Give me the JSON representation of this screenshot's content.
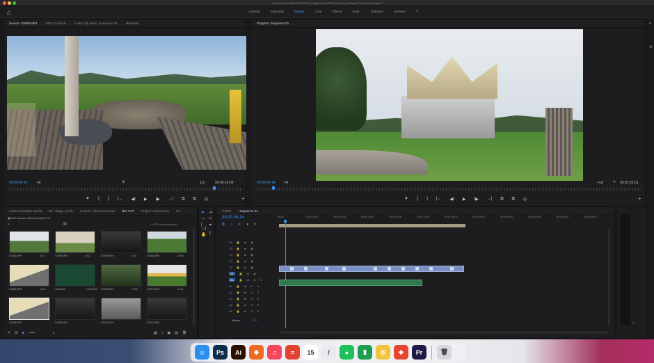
{
  "window": {
    "title": "/Volumes/Drive/Media/2023/Trip-village-resort/2023_start_to_Lifestyle/Tour/Sheet-project *"
  },
  "workspaces": {
    "items": [
      "Learning",
      "Assembly",
      "Editing",
      "Color",
      "Effects",
      "Audio",
      "Graphics",
      "Libraries"
    ],
    "active": "Editing",
    "more": "»"
  },
  "source_panel": {
    "tabs": [
      "Source: C0005.MP4",
      "Effect Controls",
      "Audio Clip Mixer: Sequence 01",
      "Metadata"
    ],
    "timecode": "00:00:04:14",
    "fit": "Fit",
    "duration": "00:00:14:00",
    "ratio": "1/2"
  },
  "program_panel": {
    "tabs": [
      "Program: Sequence 01"
    ],
    "timecode": "00:00:04:14",
    "fit": "Fit",
    "duration": "00:01:33:01",
    "ratio": "Full"
  },
  "transport": {
    "buttons": [
      "▼",
      "{",
      "}",
      "|←",
      "◀I",
      "▶",
      "I▶",
      "→|",
      "⧉",
      "⧉",
      "◎"
    ]
  },
  "project_panel": {
    "tabs": [
      "Lifeline Template Media",
      "Bin: Stage_music",
      "Project: Lofi lessons.mp4",
      "Bin: EAT",
      "Project: Lofi lessons",
      "Pic"
    ],
    "path": "Lofi: lessons Sheet-project-FLS",
    "count": "1 of 75 items selected",
    "items": [
      {
        "name": "C0001.MP4",
        "dur": "6:12",
        "style": "t-sky"
      },
      {
        "name": "C0002.MP4",
        "dur": "5:12",
        "style": "t-bldg"
      },
      {
        "name": "C0003.MP4",
        "dur": "4:10",
        "style": "t-dark"
      },
      {
        "name": "C0004.MP4",
        "dur": "15:00",
        "style": "t-green"
      },
      {
        "name": "C0005.MP4",
        "dur": "14:11",
        "style": "t-roof"
      },
      {
        "name": "Thethane",
        "dur": "1:31:19:00",
        "style": "t-audio"
      },
      {
        "name": "C0006.MP4",
        "dur": "10:00",
        "style": "t-forest"
      },
      {
        "name": "C0007.MP4",
        "dur": "19:11",
        "style": "t-flower"
      },
      {
        "name": "C0008.MP4",
        "dur": "",
        "style": "t-roof"
      },
      {
        "name": "C0009.MP4",
        "dur": "",
        "style": "t-dark"
      },
      {
        "name": "C0010.MP4",
        "dur": "",
        "style": "t-gray"
      },
      {
        "name": "C0011.MP4",
        "dur": "",
        "style": "t-dark"
      }
    ]
  },
  "timeline": {
    "tabs": [
      "C0005",
      "Sequence 01"
    ],
    "timecode": "00:00:04:14",
    "ruler_ticks": [
      "00:00",
      "00:00:15:00",
      "00:00:30:00",
      "00:00:45:00",
      "00:01:00:00",
      "00:01:15:00",
      "00:01:30:00",
      "00:01:45:00",
      "00:02:00:00",
      "00:02:15:00",
      "00:02:30:00",
      "00:02:45:00"
    ],
    "tracks": [
      "V6",
      "V5",
      "V4",
      "V3",
      "V2",
      "V1",
      "A1",
      "A2",
      "A3",
      "A4",
      "A5",
      "A6"
    ],
    "mix_label": "Master",
    "mix_value": "0.0"
  },
  "dock": {
    "apps": [
      {
        "name": "finder",
        "label": "☺",
        "color": "#2b8ff0"
      },
      {
        "name": "photoshop",
        "label": "Ps",
        "color": "#0c2e4a"
      },
      {
        "name": "illustrator",
        "label": "Ai",
        "color": "#2c0f00"
      },
      {
        "name": "brave",
        "label": "◆",
        "color": "#f06a24"
      },
      {
        "name": "music",
        "label": "♫",
        "color": "#f6475e"
      },
      {
        "name": "todoist",
        "label": "≡",
        "color": "#e34432"
      },
      {
        "name": "calendar",
        "label": "15",
        "color": "#ffffff"
      },
      {
        "name": "script",
        "label": "/",
        "color": "#e9e9ee"
      },
      {
        "name": "spotify",
        "label": "●",
        "color": "#1cc15a"
      },
      {
        "name": "numbers",
        "label": "▮",
        "color": "#1f9d4e"
      },
      {
        "name": "chrome",
        "label": "◎",
        "color": "#f3c33d"
      },
      {
        "name": "cleaner",
        "label": "◈",
        "color": "#e64530"
      },
      {
        "name": "premiere",
        "label": "Pr",
        "color": "#1d1a48"
      },
      {
        "name": "trash",
        "label": "🗑",
        "color": "#d8d8dc"
      }
    ]
  }
}
